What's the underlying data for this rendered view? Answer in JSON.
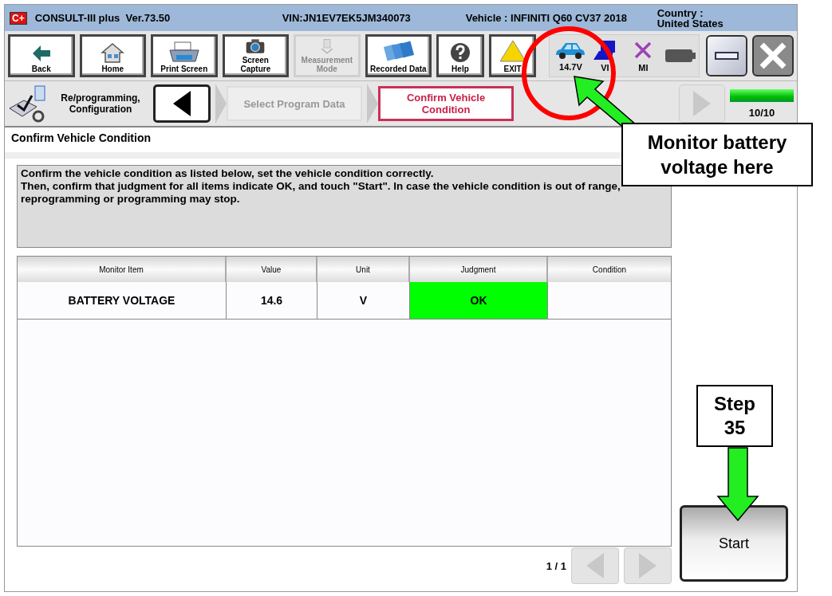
{
  "window": {
    "logo": "C+",
    "app_title": "CONSULT-III plus  Ver.73.50",
    "vin": "VIN:JN1EV7EK5JM340073",
    "vehicle": "Vehicle : INFINITI Q60 CV37 2018",
    "country": "Country : United States"
  },
  "toolbar": [
    {
      "kind": "back",
      "label": "Back",
      "disabled": false
    },
    {
      "kind": "home",
      "label": "Home",
      "disabled": false
    },
    {
      "kind": "print",
      "label": "Print Screen",
      "disabled": false
    },
    {
      "kind": "camera",
      "label": "Screen Capture",
      "disabled": false
    },
    {
      "kind": "measure",
      "label": "Measurement Mode",
      "disabled": true
    },
    {
      "kind": "recorded",
      "label": "Recorded Data",
      "disabled": false
    },
    {
      "kind": "help",
      "label": "Help",
      "disabled": false
    },
    {
      "kind": "exit",
      "label": "EXIT",
      "disabled": false
    }
  ],
  "status": [
    {
      "kind": "car",
      "label": "14.7V"
    },
    {
      "kind": "vi",
      "label": "VI"
    },
    {
      "kind": "mi",
      "label": "MI"
    },
    {
      "kind": "battery"
    }
  ],
  "breadcrumb": {
    "section": "Re/programming, Configuration",
    "steps": [
      {
        "label": "Select Program Data",
        "selected": false
      },
      {
        "label": "Confirm Vehicle Condition",
        "selected": true
      }
    ],
    "back_disabled": false,
    "next_disabled": true,
    "progress": {
      "level": 1,
      "label": "10/10"
    }
  },
  "page_title": "Confirm Vehicle Condition",
  "message": "Confirm the vehicle condition as listed below, set the vehicle condition correctly.\nThen, confirm that judgment for all items indicate OK, and touch \"Start\". In case the vehicle condition is out of range, reprogramming or programming may stop.",
  "table": {
    "columns": [
      "Monitor Item",
      "Value",
      "Unit",
      "Judgment",
      "Condition"
    ],
    "rows": [
      {
        "cells": [
          "BATTERY VOLTAGE",
          "14.6",
          "V",
          "OK",
          ""
        ],
        "pass": true
      }
    ]
  },
  "pager": {
    "label": "1 / 1",
    "prev_disabled": true,
    "next_disabled": true
  },
  "start_button": "Start",
  "annotations": [
    {
      "kind": "circle-arrow",
      "text": "Monitor battery voltage here"
    },
    {
      "kind": "down-arrow",
      "text": "Step 35"
    }
  ]
}
